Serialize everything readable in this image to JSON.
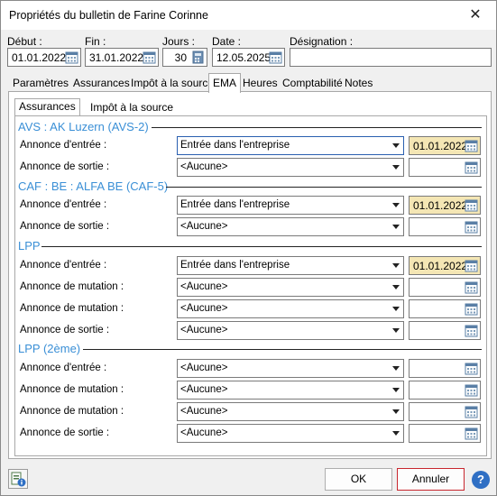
{
  "window": {
    "title": "Propriétés du bulletin de Farine Corinne"
  },
  "header": {
    "debut_label": "Début :",
    "debut_value": "01.01.2022",
    "fin_label": "Fin :",
    "fin_value": "31.01.2022",
    "jours_label": "Jours :",
    "jours_value": "30",
    "date_label": "Date :",
    "date_value": "12.05.2025",
    "designation_label": "Désignation :",
    "designation_value": ""
  },
  "tabs": [
    "Paramètres",
    "Assurances",
    "Impôt à la source",
    "EMA",
    "Heures",
    "Comptabilité",
    "Notes"
  ],
  "subtabs": [
    "Assurances",
    "Impôt à la source"
  ],
  "sections": [
    {
      "title": "AVS : AK Luzern (AVS-2)",
      "rows": [
        {
          "label": "Annonce d'entrée :",
          "value": "Entrée dans l'entreprise",
          "date": "01.01.2022"
        },
        {
          "label": "Annonce de sortie :",
          "value": "<Aucune>",
          "date": ""
        }
      ]
    },
    {
      "title": "CAF : BE : ALFA BE (CAF-5)",
      "rows": [
        {
          "label": "Annonce d'entrée :",
          "value": "Entrée dans l'entreprise",
          "date": "01.01.2022"
        },
        {
          "label": "Annonce de sortie :",
          "value": "<Aucune>",
          "date": ""
        }
      ]
    },
    {
      "title": "LPP",
      "rows": [
        {
          "label": "Annonce d'entrée :",
          "value": "Entrée dans l'entreprise",
          "date": "01.01.2022"
        },
        {
          "label": "Annonce de mutation :",
          "value": "<Aucune>",
          "date": ""
        },
        {
          "label": "Annonce de mutation :",
          "value": "<Aucune>",
          "date": ""
        },
        {
          "label": "Annonce de sortie :",
          "value": "<Aucune>",
          "date": ""
        }
      ]
    },
    {
      "title": "LPP (2ème)",
      "rows": [
        {
          "label": "Annonce d'entrée :",
          "value": "<Aucune>",
          "date": ""
        },
        {
          "label": "Annonce de mutation :",
          "value": "<Aucune>",
          "date": ""
        },
        {
          "label": "Annonce de mutation :",
          "value": "<Aucune>",
          "date": ""
        },
        {
          "label": "Annonce de sortie :",
          "value": "<Aucune>",
          "date": ""
        }
      ]
    }
  ],
  "footer": {
    "ok_label": "OK",
    "cancel_label": "Annuler",
    "help_label": "?"
  },
  "colors": {
    "section_title": "#3a8fd6",
    "date_filled_bg": "#f4e6b4",
    "cancel_border": "#c8262e"
  },
  "icons": [
    "close-icon",
    "calendar-icon",
    "calculator-icon",
    "dropdown-arrow-icon",
    "info-icon",
    "help-icon"
  ]
}
